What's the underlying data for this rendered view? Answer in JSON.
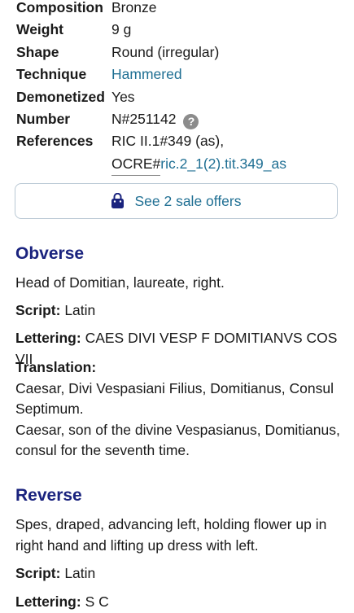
{
  "specs": {
    "composition": {
      "label": "Composition",
      "value": "Bronze"
    },
    "weight": {
      "label": "Weight",
      "value": "9 g"
    },
    "shape": {
      "label": "Shape",
      "value": "Round (irregular)"
    },
    "technique": {
      "label": "Technique",
      "value": "Hammered"
    },
    "demonetized": {
      "label": "Demonetized",
      "value": "Yes"
    },
    "number": {
      "label": "Number",
      "value": "N#251142",
      "help_icon": "question-circle-icon"
    },
    "references": {
      "label": "References",
      "line1": "RIC II.1#349 (as),",
      "ocre_prefix": "OCRE#",
      "ocre_link": "ric.2_1(2).tit.349_as"
    }
  },
  "sale_offers": {
    "icon": "shopping-bag-icon",
    "label": "See 2 sale offers"
  },
  "obverse": {
    "title": "Obverse",
    "description": "Head of Domitian, laureate, right.",
    "script_label": "Script:",
    "script_value": "Latin",
    "lettering_label": "Lettering:",
    "lettering_value": "CAES DIVI VESP F DOMITIANVS COS VII",
    "translation_label": "Translation:",
    "translation_line1": "Caesar, Divi Vespasiani Filius, Domitianus, Consul Septimum.",
    "translation_line2": "Caesar, son of the divine Vespasianus, Domitianus, consul for the seventh time."
  },
  "reverse": {
    "title": "Reverse",
    "description": "Spes, draped, advancing left, holding flower up in right hand and lifting up dress with left.",
    "script_label": "Script:",
    "script_value": "Latin",
    "lettering_label": "Lettering:",
    "lettering_value": "S C"
  },
  "colors": {
    "heading": "#1a237e",
    "link": "#1f6f93",
    "button_border": "#b9c8d4",
    "help_icon": "#8c8c8c"
  }
}
